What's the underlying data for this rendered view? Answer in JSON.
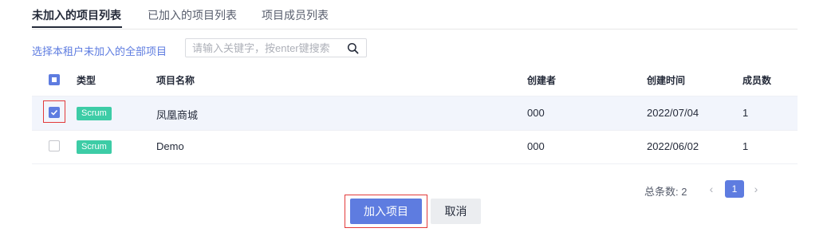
{
  "tabs": [
    {
      "label": "未加入的项目列表",
      "active": true
    },
    {
      "label": "已加入的项目列表",
      "active": false
    },
    {
      "label": "项目成员列表",
      "active": false
    }
  ],
  "scope_link": "选择本租户未加入的全部项目",
  "search": {
    "placeholder": "请输入关键字，按enter键搜索",
    "value": ""
  },
  "table": {
    "headers": {
      "type": "类型",
      "name": "项目名称",
      "creator": "创建者",
      "created_at": "创建时间",
      "members": "成员数"
    },
    "select_all_state": "partial",
    "rows": [
      {
        "selected": true,
        "type": "Scrum",
        "name": "凤凰商城",
        "creator": "000",
        "created_at": "2022/07/04",
        "members": "1"
      },
      {
        "selected": false,
        "type": "Scrum",
        "name": "Demo",
        "creator": "000",
        "created_at": "2022/06/02",
        "members": "1"
      }
    ]
  },
  "pagination": {
    "total_label": "总条数: 2",
    "current_page": "1"
  },
  "actions": {
    "primary": "加入项目",
    "secondary": "取消"
  },
  "colors": {
    "accent": "#5e7ce0",
    "badge": "#3dcca6",
    "highlight": "#e23a3a"
  }
}
